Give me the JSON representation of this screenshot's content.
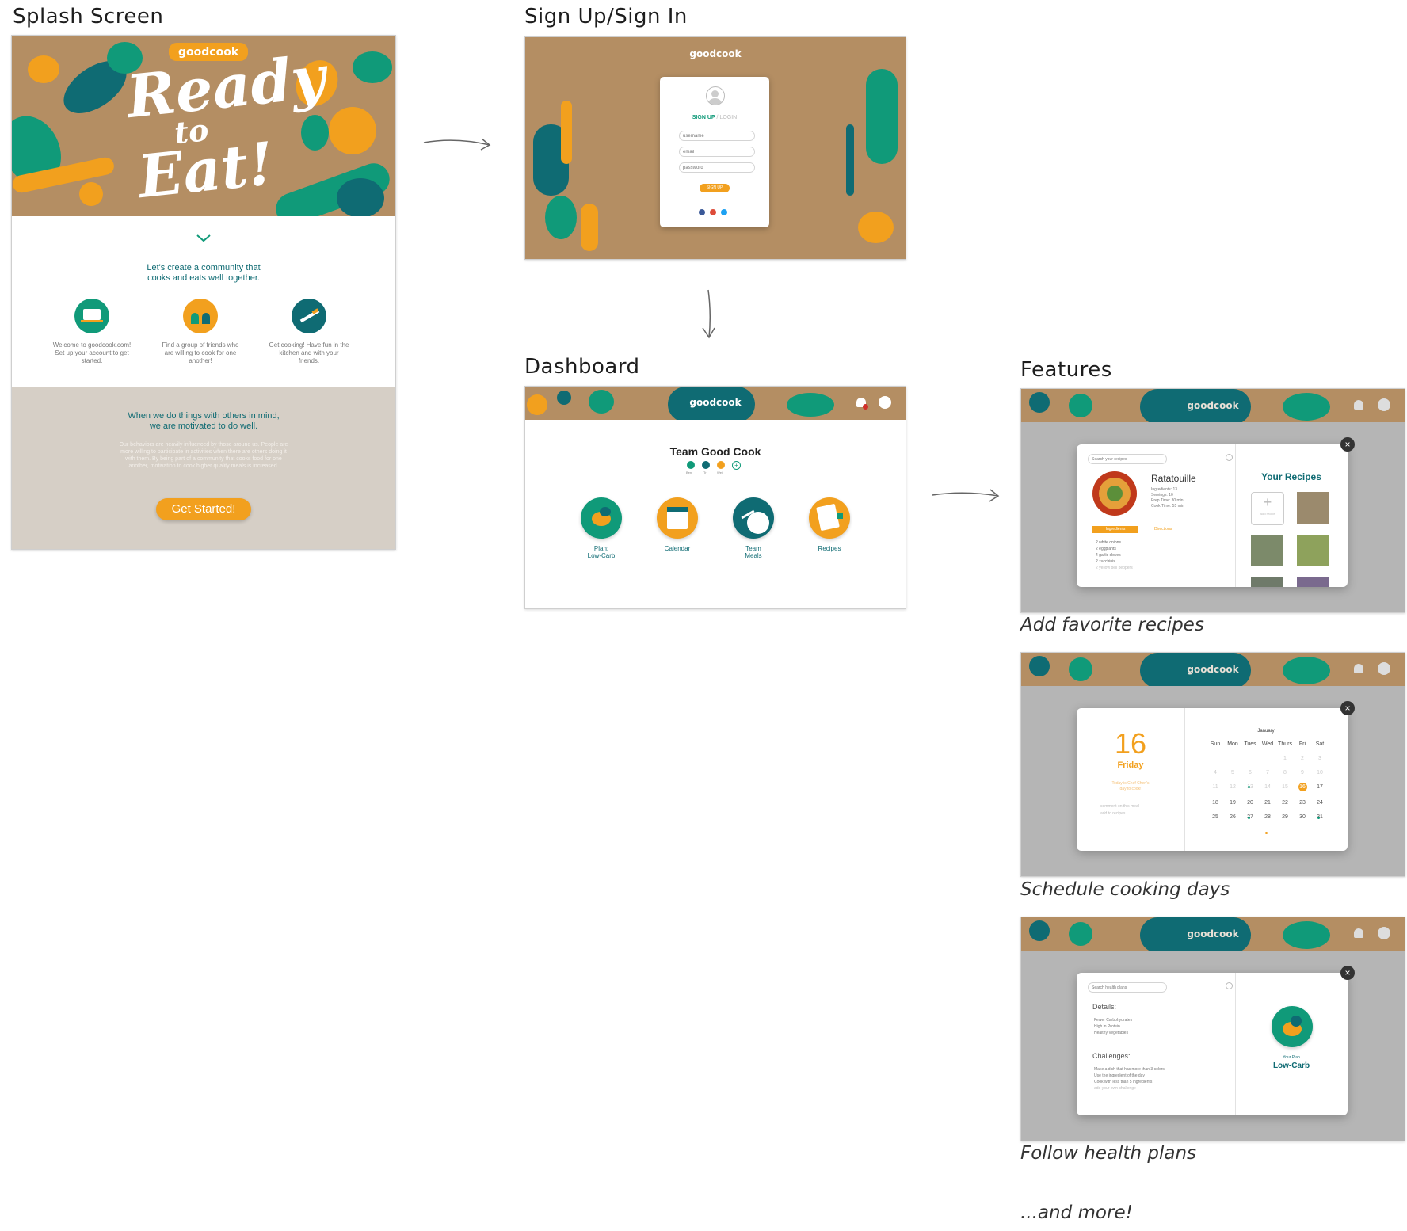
{
  "sections": {
    "splash": "Splash Screen",
    "signin": "Sign Up/Sign In",
    "dashboard": "Dashboard",
    "features": "Features"
  },
  "brand": "goodcook",
  "splash": {
    "hero_line1": "Ready",
    "hero_line2": "to",
    "hero_line3": "Eat!",
    "tagline_1": "Let's create a community that",
    "tagline_2": "cooks and eats well together.",
    "steps": [
      {
        "text": "Welcome to goodcook.com! Set up your account to get started.",
        "icon": "laptop-icon"
      },
      {
        "text": "Find a group of friends who are willing to cook for one another!",
        "icon": "group-icon"
      },
      {
        "text": "Get cooking! Have fun in the kitchen and with your friends.",
        "icon": "knife-icon"
      }
    ],
    "quote_1": "When we do things with others in mind,",
    "quote_2": "we are motivated to do well.",
    "paragraph": "Our behaviors are heavily influenced by those around us. People are more willing to participate in activities when there are others doing it with them. By being part of a community that cooks food for one another, motivation to cook higher quality meals is increased.",
    "cta": "Get Started!"
  },
  "signin": {
    "tab_signup": "SIGN UP",
    "tab_separator": "/",
    "tab_login": "LOGIN",
    "username_placeholder": "username",
    "email_placeholder": "email",
    "password_placeholder": "password",
    "submit": "SIGN UP"
  },
  "dashboard": {
    "team_name": "Team Good Cook",
    "members": [
      "Ben",
      "Tr",
      "Wei"
    ],
    "tiles": [
      {
        "label_1": "Plan:",
        "label_2": "Low-Carb",
        "icon": "eggplant-icon"
      },
      {
        "label_1": "Calendar",
        "label_2": "",
        "icon": "calendar-icon"
      },
      {
        "label_1": "Team",
        "label_2": "Meals",
        "icon": "plate-icon"
      },
      {
        "label_1": "Recipes",
        "label_2": "",
        "icon": "notepad-icon"
      }
    ]
  },
  "features": {
    "recipes": {
      "caption": "Add favorite recipes",
      "search_placeholder": "Search your recipes",
      "recipe_name": "Ratatouille",
      "meta": [
        "Ingredients: 13",
        "Servings: 10",
        "Prep Time: 30 min",
        "Cook Time: 55 min"
      ],
      "tab_ingredients": "Ingredients",
      "tab_directions": "Directions",
      "ingredients": [
        "2 white onions",
        "2 eggplants",
        "4 garlic cloves",
        "2 zucchinis",
        "2 yellow bell peppers"
      ],
      "your_recipes": "Your Recipes",
      "add_recipe": "Add recipe",
      "add_symbol": "+"
    },
    "calendar": {
      "caption": "Schedule cooking days",
      "day_number": "16",
      "day_name": "Friday",
      "note_1": "Today is Chef Chen's",
      "note_2": "day to cook!",
      "link_1": "comment on this meal",
      "link_2": "add to recipes",
      "month": "January",
      "weekdays": [
        "Sun",
        "Mon",
        "Tues",
        "Wed",
        "Thurs",
        "Fri",
        "Sat"
      ],
      "weeks": [
        [
          "",
          "",
          "",
          "",
          "1",
          "2",
          "3"
        ],
        [
          "4",
          "5",
          "6",
          "7",
          "8",
          "9",
          "10"
        ],
        [
          "11",
          "12",
          "13",
          "14",
          "15",
          "16",
          "17"
        ],
        [
          "18",
          "19",
          "20",
          "21",
          "22",
          "23",
          "24"
        ],
        [
          "25",
          "26",
          "27",
          "28",
          "29",
          "30",
          "31"
        ]
      ],
      "selected_day": "16"
    },
    "plans": {
      "caption": "Follow health plans",
      "search_placeholder": "Search health plans",
      "details_title": "Details:",
      "details": [
        "Fewer Carbohydrates",
        "High in Protein",
        "Healthy Vegetables"
      ],
      "challenges_title": "Challenges:",
      "challenges": [
        "Make a dish that has more than 3 colors",
        "Use the ingredient of the day",
        "Cook with less than 5 ingredients",
        "add your own challenge"
      ],
      "your_plan": "Your Plan",
      "plan_name": "Low-Carb"
    },
    "more": "...and more!"
  },
  "colors": {
    "kraft": "#b48e63",
    "teal": "#0f6b73",
    "green": "#109a79",
    "orange": "#f2a01e",
    "sand": "#d6cfc6"
  }
}
